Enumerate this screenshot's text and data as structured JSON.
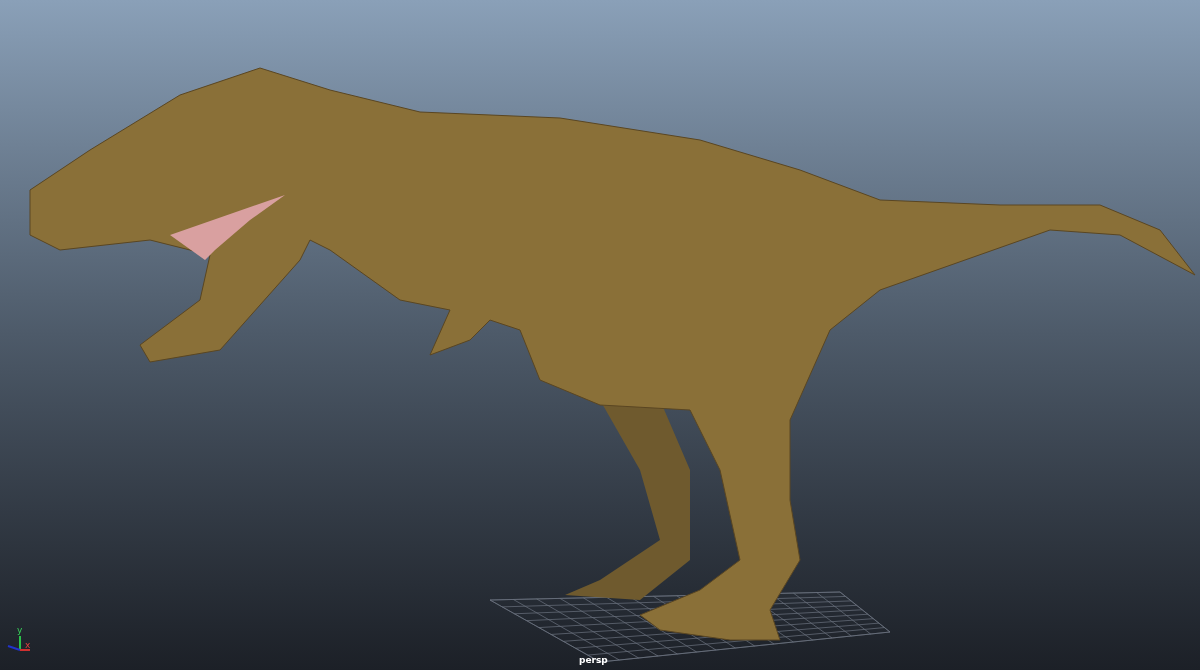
{
  "viewport": {
    "camera_label": "persp",
    "axis_gizmo": {
      "y_label": "y",
      "x_label": "x"
    }
  }
}
